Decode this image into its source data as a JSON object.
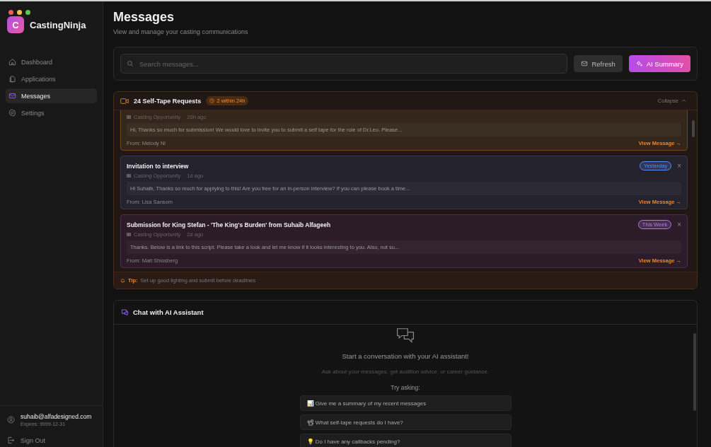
{
  "app": {
    "logo_letter": "C",
    "name": "CastingNinja"
  },
  "sidebar": {
    "items": [
      {
        "label": "Dashboard",
        "selected": false
      },
      {
        "label": "Applications",
        "selected": false
      },
      {
        "label": "Messages",
        "selected": true
      },
      {
        "label": "Settings",
        "selected": false
      }
    ],
    "user": {
      "email": "suhaib@alfadesigned.com",
      "expires": "Expires: 9999-12-31"
    },
    "sign_out": "Sign Out"
  },
  "page": {
    "title": "Messages",
    "subtitle": "View and manage your casting communications"
  },
  "search": {
    "placeholder": "Search messages..."
  },
  "buttons": {
    "refresh": "Refresh",
    "ai_summary": "AI Summary"
  },
  "self_tape": {
    "title": "24 Self-Tape Requests",
    "urgent_badge": "2 within 24h",
    "collapse": "Collapse",
    "expanded": true,
    "messages": [
      {
        "kind": "urgent",
        "meta": "Casting Opportunity",
        "age": "20h ago",
        "preview": "Hi, Thanks so much for submission! We would love to invite you to submit a self tape for the role of Dr.Leo. Please...",
        "from": "From: Melody Ni",
        "link": "View Message →"
      },
      {
        "kind": "recent",
        "title": "Invitation to interview",
        "badge": "Yesterday",
        "color": "#5b8def",
        "close": "×",
        "meta": "Casting Opportunity",
        "age": "1d ago",
        "preview": "Hi Suhaib, Thanks so much for applying to this! Are you free for an in-person interview? If you can please book a time...",
        "from": "From: Lisa Sansom",
        "link": "View Message →"
      },
      {
        "kind": "week",
        "title": "Submission for King Stefan - 'The King's Burden' from Suhaib Alfageeh",
        "badge": "This Week",
        "color": "#b07ae0",
        "close": "×",
        "meta": "Casting Opportunity",
        "age": "2d ago",
        "preview": "Thanks. Below is a link to this script. Please take a look and let me know if it looks interesting to you. Also, not su...",
        "from": "From: Matt Shlosberg",
        "link": "View Message →"
      }
    ],
    "tip_label": "Tip:",
    "tip": "Set up good lighting and submit before deadlines"
  },
  "chat": {
    "title": "Chat with AI Assistant",
    "empty_title": "Start a conversation with your AI assistant!",
    "empty_text": "Ask about your messages, get audition advice, or career guidance.",
    "try_label": "Try asking:",
    "suggestions": [
      "📊 Give me a summary of my recent messages",
      "📽 What self-tape requests do I have?",
      "💡 Do I have any callbacks pending?"
    ]
  }
}
